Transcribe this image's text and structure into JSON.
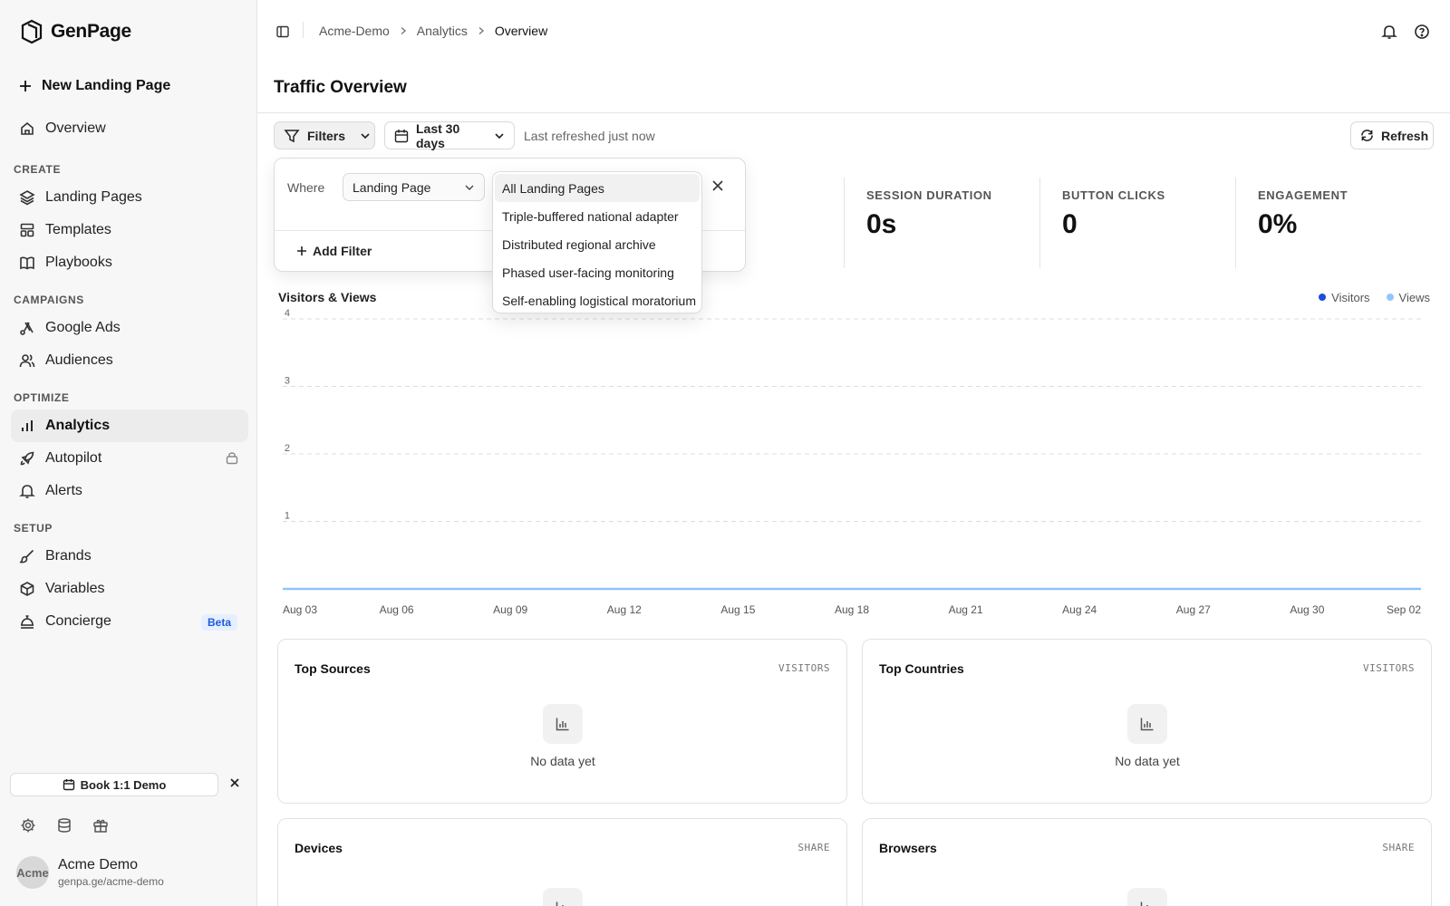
{
  "app": {
    "name": "GenPage"
  },
  "sidebar": {
    "new_page_label": "New Landing Page",
    "overview_label": "Overview",
    "sections": {
      "create": "CREATE",
      "campaigns": "CAMPAIGNS",
      "optimize": "OPTIMIZE",
      "setup": "SETUP"
    },
    "items": {
      "landing_pages": "Landing Pages",
      "templates": "Templates",
      "playbooks": "Playbooks",
      "google_ads": "Google Ads",
      "audiences": "Audiences",
      "analytics": "Analytics",
      "autopilot": "Autopilot",
      "alerts": "Alerts",
      "brands": "Brands",
      "variables": "Variables",
      "concierge": "Concierge"
    },
    "concierge_badge": "Beta",
    "demo_button": "Book 1:1 Demo",
    "user": {
      "name": "Acme Demo",
      "url": "genpa.ge/acme-demo",
      "avatar_alt": "Acme"
    }
  },
  "breadcrumb": [
    "Acme-Demo",
    "Analytics",
    "Overview"
  ],
  "page": {
    "title": "Traffic Overview",
    "filters_label": "Filters",
    "range_label": "Last 30 days",
    "refreshed_text": "Last refreshed just now",
    "refresh_label": "Refresh"
  },
  "stats": [
    {
      "label": "SESSION DURATION",
      "value": "0s"
    },
    {
      "label": "BUTTON CLICKS",
      "value": "0"
    },
    {
      "label": "ENGAGEMENT",
      "value": "0%"
    }
  ],
  "filter_popover": {
    "where_label": "Where",
    "field_value": "Landing Page",
    "add_filter_label": "Add Filter",
    "options": [
      "All Landing Pages",
      "Triple-buffered national adapter",
      "Distributed regional archive",
      "Phased user-facing monitoring",
      "Self-enabling logistical moratorium"
    ],
    "selected_index": 0
  },
  "chart_data": {
    "type": "line",
    "title": "Visitors & Views",
    "categories": [
      "Aug 03",
      "Aug 06",
      "Aug 09",
      "Aug 12",
      "Aug 15",
      "Aug 18",
      "Aug 21",
      "Aug 24",
      "Aug 27",
      "Aug 30",
      "Sep 02"
    ],
    "series": [
      {
        "name": "Visitors",
        "color": "#1d4ed8",
        "values": [
          0,
          0,
          0,
          0,
          0,
          0,
          0,
          0,
          0,
          0,
          0
        ]
      },
      {
        "name": "Views",
        "color": "#93c5fd",
        "values": [
          0,
          0,
          0,
          0,
          0,
          0,
          0,
          0,
          0,
          0,
          0
        ]
      }
    ],
    "yticks": [
      1,
      2,
      3,
      4
    ],
    "ylim": [
      0,
      4
    ],
    "grid": true,
    "legend": "top-right"
  },
  "cards": [
    {
      "title": "Top Sources",
      "meta": "VISITORS",
      "empty": "No data yet"
    },
    {
      "title": "Top Countries",
      "meta": "VISITORS",
      "empty": "No data yet"
    },
    {
      "title": "Devices",
      "meta": "SHARE",
      "empty": ""
    },
    {
      "title": "Browsers",
      "meta": "SHARE",
      "empty": ""
    }
  ]
}
